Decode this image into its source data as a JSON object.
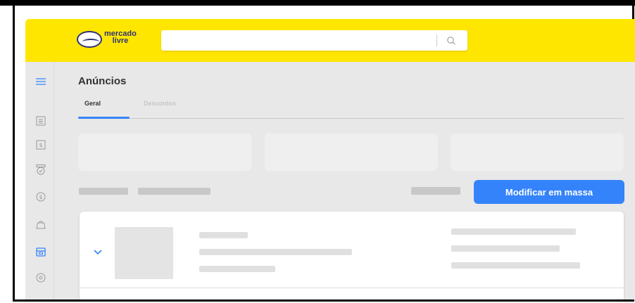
{
  "header": {
    "logo_line1": "mercado",
    "logo_line2": "livre",
    "search": {
      "value": "",
      "placeholder": ""
    },
    "search_icon": "search-icon"
  },
  "sidebar": {
    "items": [
      {
        "icon": "menu-icon"
      },
      {
        "icon": "list-icon"
      },
      {
        "icon": "price-tag-icon"
      },
      {
        "icon": "badge-icon"
      },
      {
        "icon": "dollar-icon"
      },
      {
        "icon": "shopping-bag-icon"
      },
      {
        "icon": "store-icon",
        "active": true
      },
      {
        "icon": "settings-icon"
      }
    ]
  },
  "main": {
    "title": "Anúncios",
    "tabs": [
      {
        "label": "Geral",
        "active": true
      },
      {
        "label": "Descontos",
        "active": false
      }
    ],
    "bulk_button_label": "Modificar em massa"
  },
  "colors": {
    "header_bg": "#ffe600",
    "accent": "#3483fa",
    "brand_navy": "#2d3277",
    "page_bg": "#e8e8e8"
  }
}
